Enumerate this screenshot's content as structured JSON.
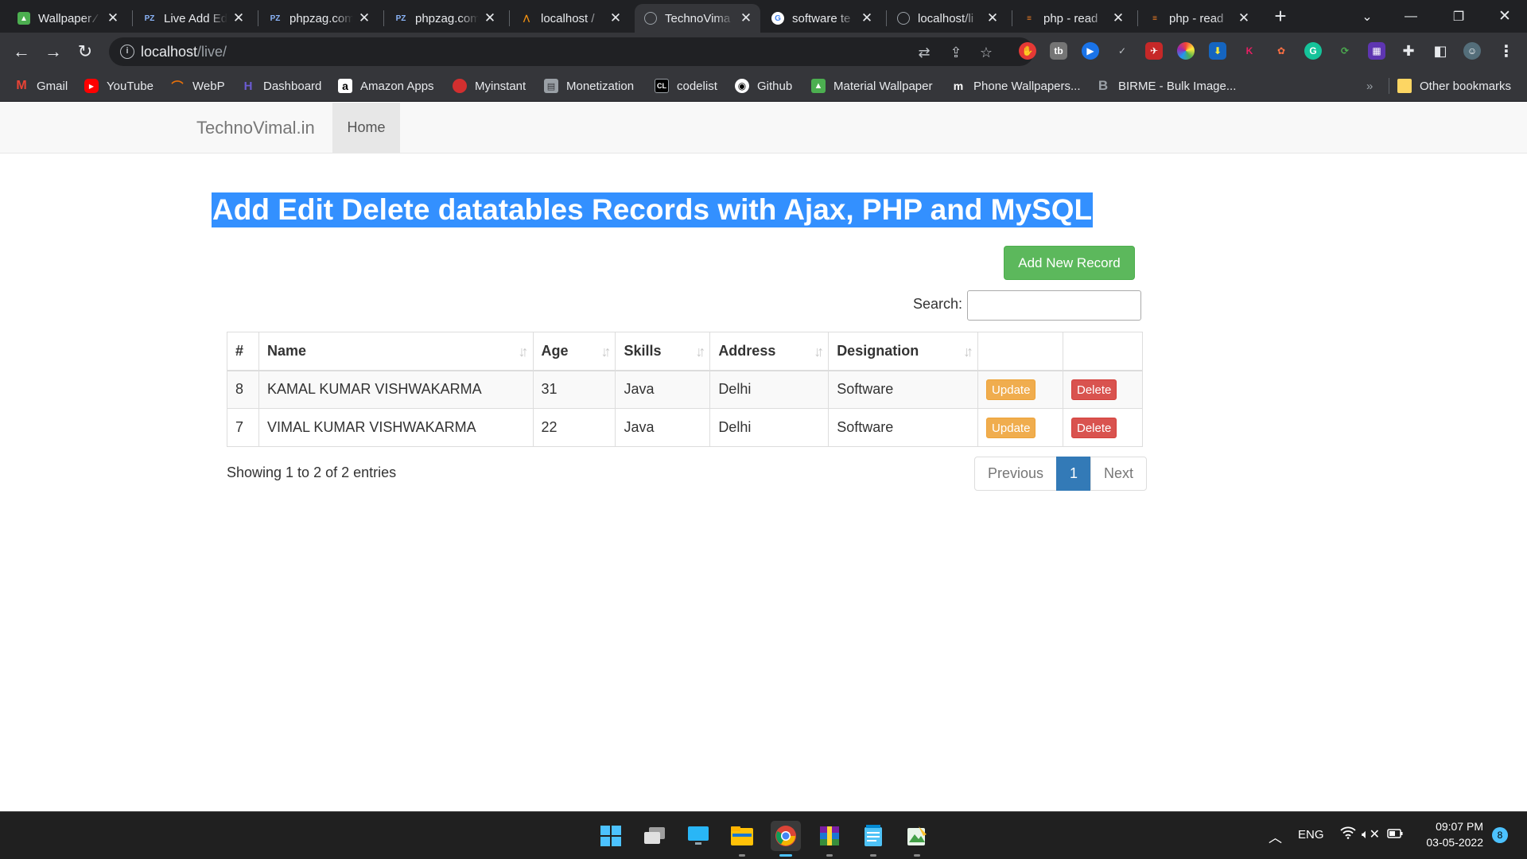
{
  "browser": {
    "tabs": [
      {
        "title": "Wallpaper ⁄",
        "icon": "image-icon",
        "color": "#4caf50"
      },
      {
        "title": "Live Add Ed",
        "icon": "phpzag-icon",
        "color": "#8ab4f8"
      },
      {
        "title": "phpzag.com",
        "icon": "phpzag-icon",
        "color": "#8ab4f8"
      },
      {
        "title": "phpzag.com",
        "icon": "phpzag-icon",
        "color": "#8ab4f8"
      },
      {
        "title": "localhost / ",
        "icon": "phpmyadmin-icon",
        "color": "#f29111"
      },
      {
        "title": "TechnoVima",
        "icon": "globe-icon",
        "color": "#9aa0a6"
      },
      {
        "title": "software te",
        "icon": "google-icon",
        "color": "#4285f4"
      },
      {
        "title": "localhost/li",
        "icon": "globe-icon",
        "color": "#9aa0a6"
      },
      {
        "title": "php - read ",
        "icon": "stackoverflow-icon",
        "color": "#f48024"
      },
      {
        "title": "php - read ",
        "icon": "stackoverflow-icon",
        "color": "#f48024"
      }
    ],
    "new_tab": "+",
    "url_host": "localhost",
    "url_path": "/live/",
    "bookmarks": [
      {
        "label": "Gmail",
        "icon": "gmail-icon",
        "color": "#ea4335"
      },
      {
        "label": "YouTube",
        "icon": "youtube-icon",
        "color": "#ff0000"
      },
      {
        "label": "WebP",
        "icon": "webp-icon",
        "color": "#e8710a"
      },
      {
        "label": "Dashboard",
        "icon": "dashboard-icon",
        "color": "#6b5bd2"
      },
      {
        "label": "Amazon Apps",
        "icon": "amazon-icon",
        "color": "#ffffff"
      },
      {
        "label": "Myinstant",
        "icon": "myinstant-icon",
        "color": "#d32f2f"
      },
      {
        "label": "Monetization",
        "icon": "monetization-icon",
        "color": "#9aa0a6"
      },
      {
        "label": "codelist",
        "icon": "codelist-icon",
        "color": "#202124"
      },
      {
        "label": "Github",
        "icon": "github-icon",
        "color": "#ffffff"
      },
      {
        "label": "Material Wallpaper",
        "icon": "image-icon",
        "color": "#4caf50"
      },
      {
        "label": "Phone Wallpapers...",
        "icon": "m-icon",
        "color": "#202124"
      },
      {
        "label": "BIRME - Bulk Image...",
        "icon": "birme-icon",
        "color": "#35363a"
      }
    ],
    "more_bookmarks": "»",
    "other_bookmarks": "Other bookmarks"
  },
  "page": {
    "brand": "TechnoVimal.in",
    "nav_home": "Home",
    "title": "Add Edit Delete datatables Records with Ajax, PHP and MySQL",
    "add_button": "Add New Record",
    "search_label": "Search:",
    "search_value": "",
    "table": {
      "headers": [
        "#",
        "Name",
        "Age",
        "Skills",
        "Address",
        "Designation",
        "",
        ""
      ],
      "rows": [
        {
          "id": "8",
          "name": "KAMAL KUMAR VISHWAKARMA",
          "age": "31",
          "skills": "Java",
          "address": "Delhi",
          "designation": "Software",
          "update": "Update",
          "delete": "Delete"
        },
        {
          "id": "7",
          "name": "VIMAL KUMAR VISHWAKARMA",
          "age": "22",
          "skills": "Java",
          "address": "Delhi",
          "designation": "Software",
          "update": "Update",
          "delete": "Delete"
        }
      ]
    },
    "info": "Showing 1 to 2 of 2 entries",
    "pagination": {
      "previous": "Previous",
      "current": "1",
      "next": "Next"
    }
  },
  "taskbar": {
    "apps": [
      "windows-start-icon",
      "task-view-icon",
      "desktop-icon",
      "file-explorer-icon",
      "chrome-icon",
      "winrar-icon",
      "notepad-icon",
      "image-editor-icon"
    ],
    "language": "ENG",
    "time": "09:07 PM",
    "date": "03-05-2022",
    "notifications": "8"
  }
}
